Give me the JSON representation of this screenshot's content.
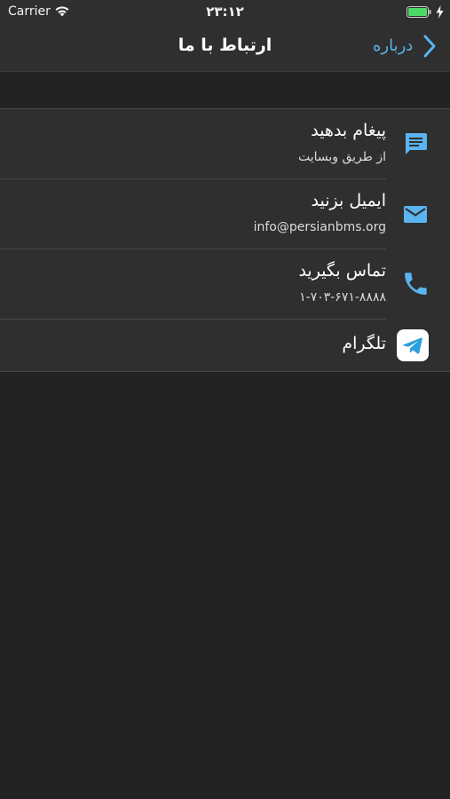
{
  "status_bar": {
    "carrier": "Carrier",
    "time": "۲۳:۱۲"
  },
  "nav": {
    "title": "ارتباط با ما",
    "back_label": "درباره"
  },
  "contacts": [
    {
      "icon": "message-icon",
      "title": "پیغام بدهید",
      "subtitle": "از طریق وبسایت"
    },
    {
      "icon": "mail-icon",
      "title": "ایمیل بزنید",
      "subtitle": "info@persianbms.org"
    },
    {
      "icon": "phone-icon",
      "title": "تماس بگیرید",
      "subtitle": "۱-۷۰۳-۶۷۱-۸۸۸۸"
    },
    {
      "icon": "telegram-icon",
      "title": "تلگرام"
    }
  ],
  "colors": {
    "accent": "#5ab4f0",
    "battery": "#4cd964",
    "background": "#232323",
    "bar": "#2f2f2f"
  }
}
